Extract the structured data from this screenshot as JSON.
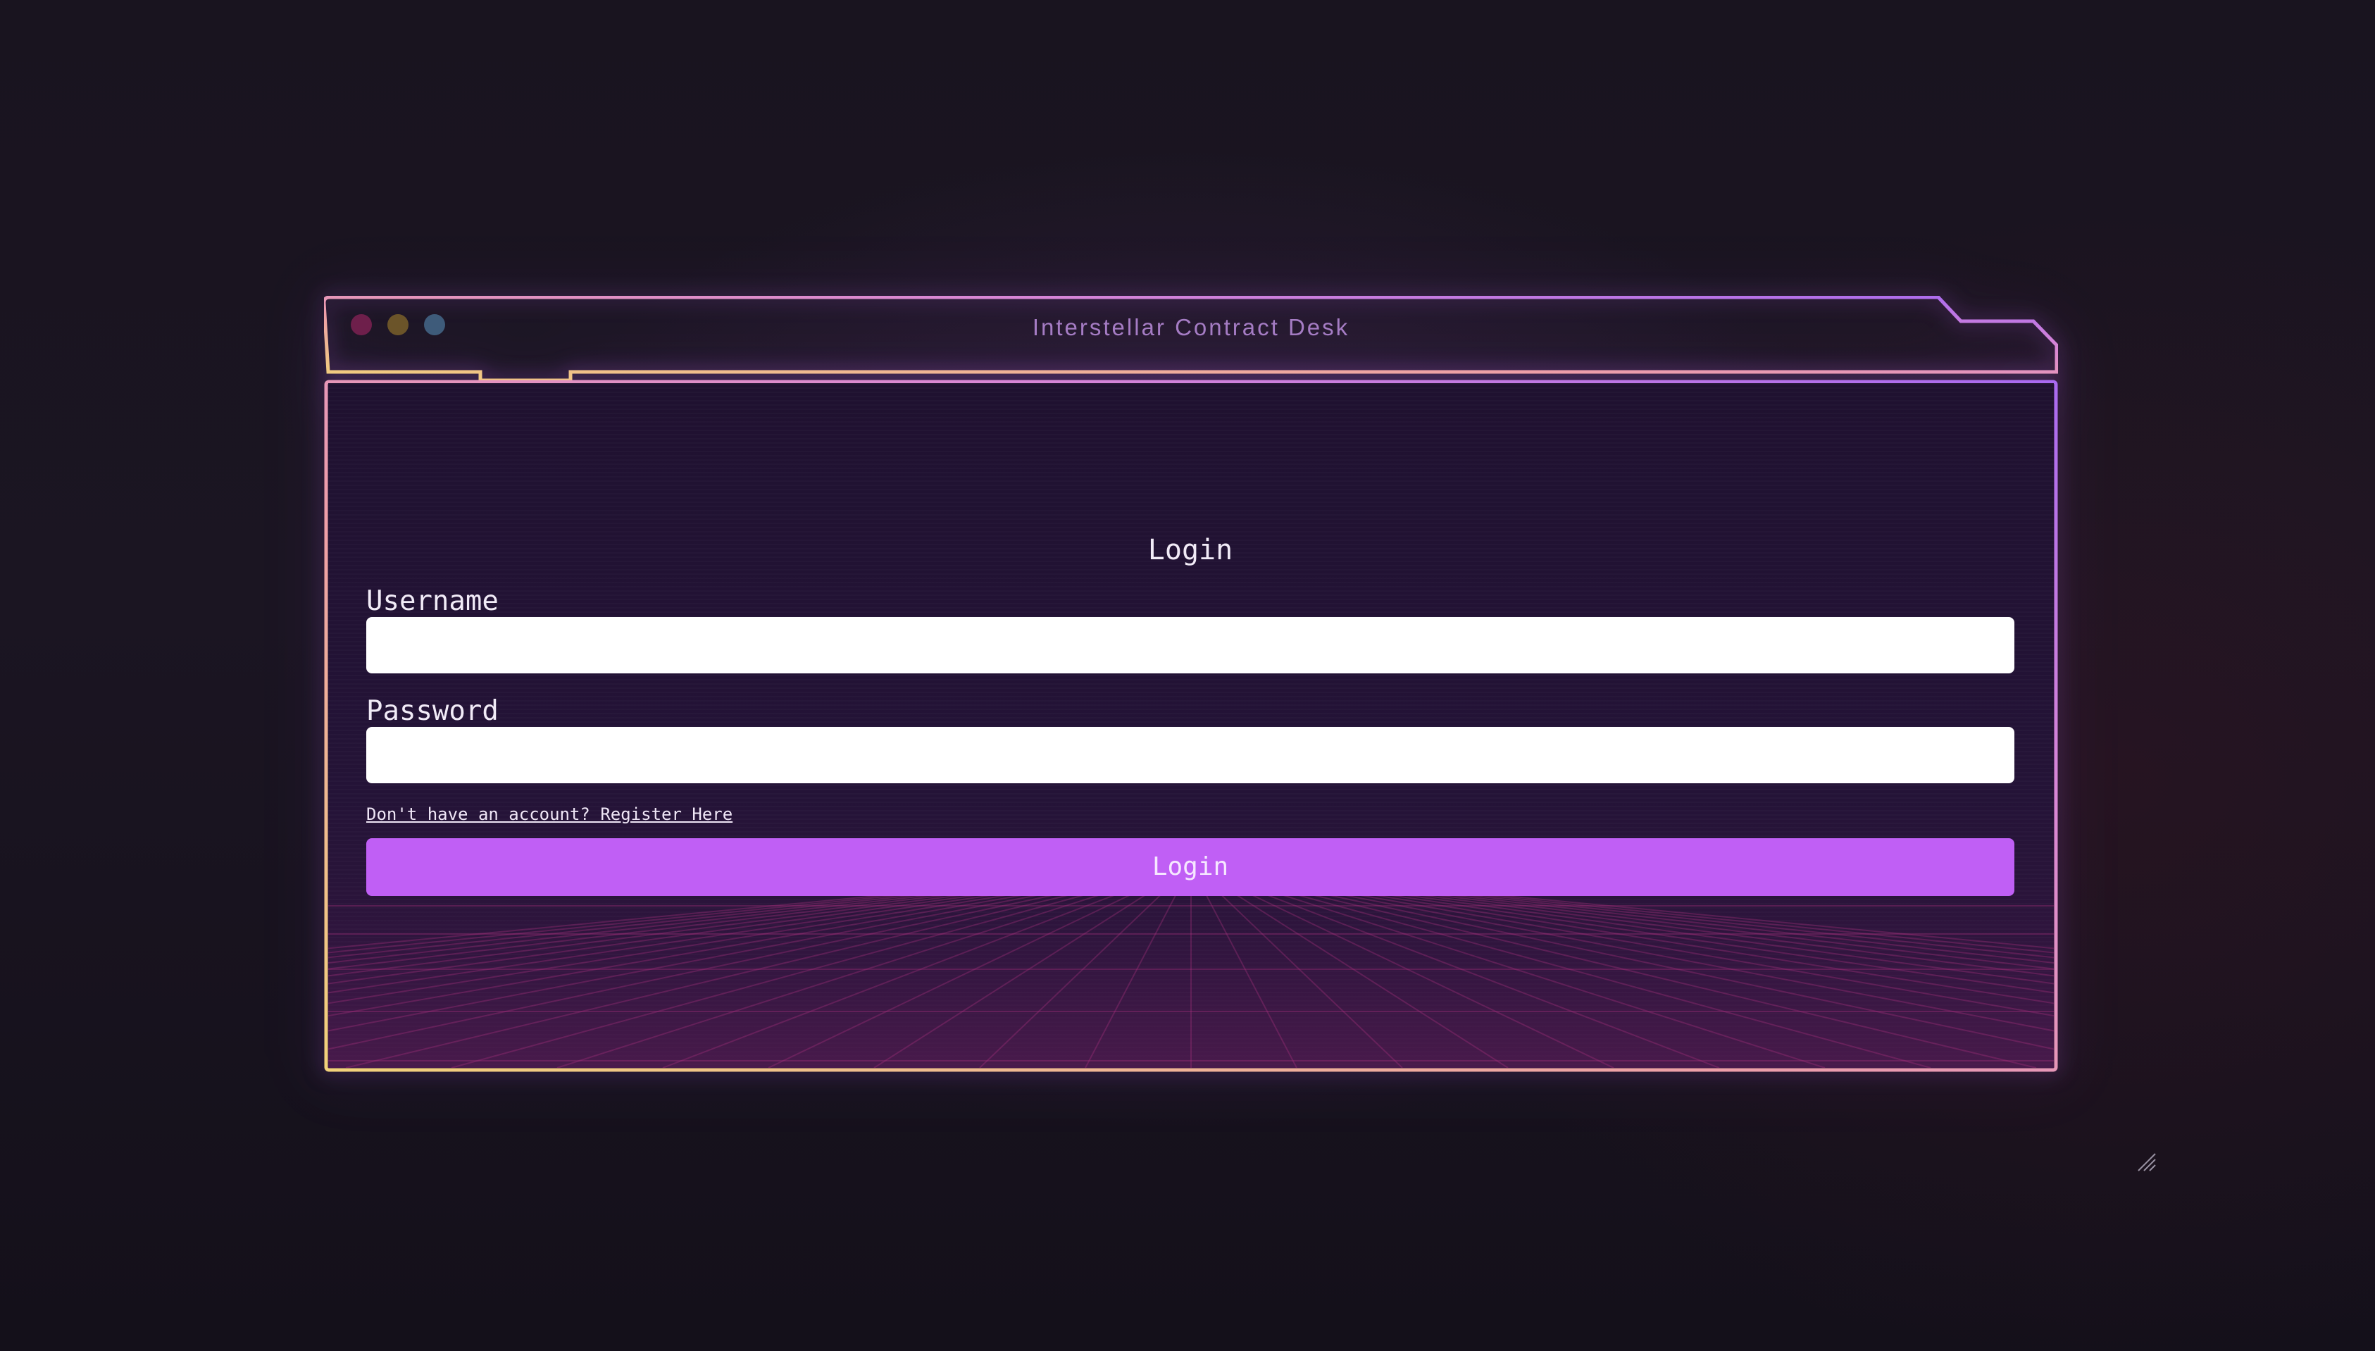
{
  "window": {
    "title": "Interstellar Contract Desk",
    "controls": [
      "close",
      "minimize",
      "maximize"
    ]
  },
  "login_form": {
    "title": "Login",
    "username_label": "Username",
    "username_value": "",
    "password_label": "Password",
    "password_value": "",
    "register_link": "Don't have an account? Register Here",
    "submit_label": "Login"
  },
  "colors": {
    "accent": "#c05ff5",
    "frame_gradient": [
      "#f2d27a",
      "#e88cc8",
      "#b06ef2"
    ],
    "title_text": "#a57cc4"
  }
}
